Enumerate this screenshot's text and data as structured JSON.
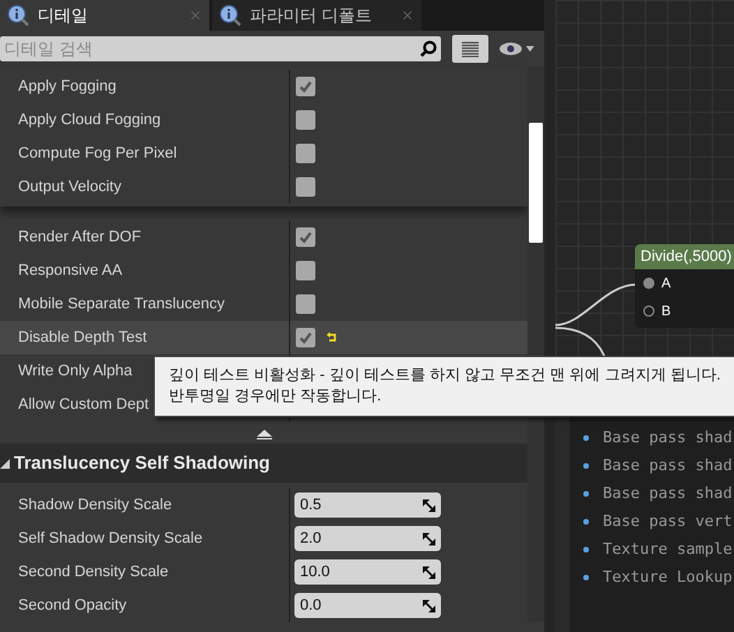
{
  "tabs": [
    {
      "label": "디테일",
      "selected": true
    },
    {
      "label": "파라미터 디폴트",
      "selected": false
    }
  ],
  "search": {
    "placeholder": "디테일 검색"
  },
  "groups": [
    {
      "rows": [
        {
          "label": "Apply Fogging",
          "kind": "checkbox",
          "checked": true,
          "modified": false,
          "selected": false
        },
        {
          "label": "Apply Cloud Fogging",
          "kind": "checkbox",
          "checked": false,
          "modified": false,
          "selected": false
        },
        {
          "label": "Compute Fog Per Pixel",
          "kind": "checkbox",
          "checked": false,
          "modified": false,
          "selected": false
        },
        {
          "label": "Output Velocity",
          "kind": "checkbox",
          "checked": false,
          "modified": false,
          "selected": false
        }
      ]
    },
    {
      "rows": [
        {
          "label": "Render After DOF",
          "kind": "checkbox",
          "checked": true,
          "modified": false,
          "selected": false
        },
        {
          "label": "Responsive AA",
          "kind": "checkbox",
          "checked": false,
          "modified": false,
          "selected": false
        },
        {
          "label": "Mobile Separate Translucency",
          "kind": "checkbox",
          "checked": false,
          "modified": false,
          "selected": false
        },
        {
          "label": "Disable Depth Test",
          "kind": "checkbox",
          "checked": true,
          "modified": true,
          "selected": true
        },
        {
          "label": "Write Only Alpha",
          "kind": "label",
          "modified": false,
          "selected": false
        },
        {
          "label": "Allow Custom Dept",
          "kind": "label",
          "modified": false,
          "selected": false
        }
      ]
    }
  ],
  "section": {
    "title": "Translucency Self Shadowing",
    "expanded": true,
    "rows": [
      {
        "label": "Shadow Density Scale",
        "value": "0.5"
      },
      {
        "label": "Self Shadow Density Scale",
        "value": "2.0"
      },
      {
        "label": "Second Density Scale",
        "value": "10.0"
      },
      {
        "label": "Second Opacity",
        "value": "0.0"
      }
    ]
  },
  "tooltip": {
    "lines": [
      "깊이 테스트 비활성화 - 깊이 테스트를 하지 않고 무조건 맨 위에 그려지게 됩니다.",
      "반투명일 경우에만 작동합니다."
    ]
  },
  "node": {
    "title": "Divide(,5000)",
    "pins": [
      {
        "label": "A",
        "connected": true
      },
      {
        "label": "B",
        "connected": false
      }
    ]
  },
  "stats": [
    "Base pass shad",
    "Base pass shad",
    "Base pass shad",
    "Base pass vert",
    "Texture sample",
    "Texture Lookup"
  ]
}
